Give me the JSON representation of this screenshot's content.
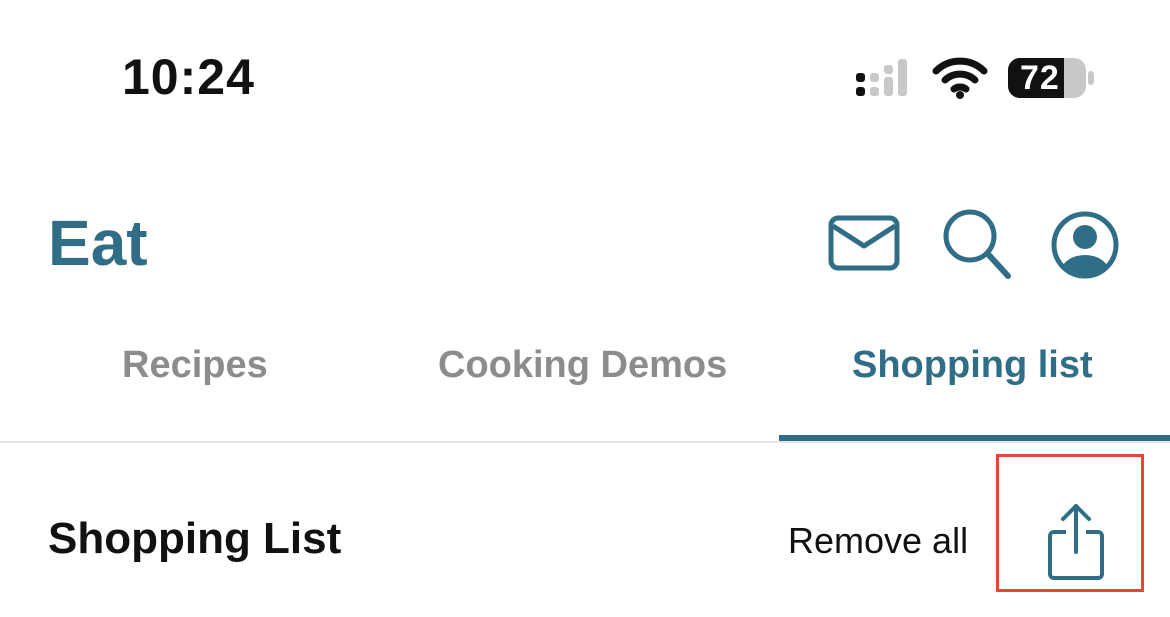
{
  "status_bar": {
    "time": "10:24",
    "battery_level": "72",
    "icons": [
      "signal-icon",
      "wifi-icon",
      "battery-icon"
    ]
  },
  "header": {
    "title": "Eat",
    "icons": [
      "mail-icon",
      "search-icon",
      "profile-icon"
    ]
  },
  "tabs": [
    {
      "label": "Recipes",
      "active": false
    },
    {
      "label": "Cooking Demos",
      "active": false
    },
    {
      "label": "Shopping list",
      "active": true
    }
  ],
  "section": {
    "title": "Shopping List",
    "remove_all_label": "Remove all",
    "share_icon": "share-icon"
  },
  "colors": {
    "accent": "#2f6e86",
    "inactive_tab": "#8c8c8c",
    "highlight_box": "#e8472f",
    "text": "#111111"
  }
}
